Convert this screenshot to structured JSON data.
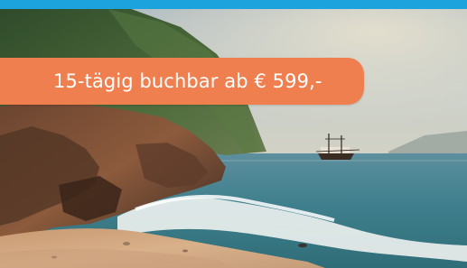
{
  "banner": {
    "price_text": "15-tägig buchbar ab € 599,-"
  },
  "colors": {
    "top_strip": "#1ca2dc",
    "badge": "#ef7f4f",
    "badge_text": "#ffffff"
  },
  "icons": {
    "ship": "sailing-ship-icon"
  }
}
